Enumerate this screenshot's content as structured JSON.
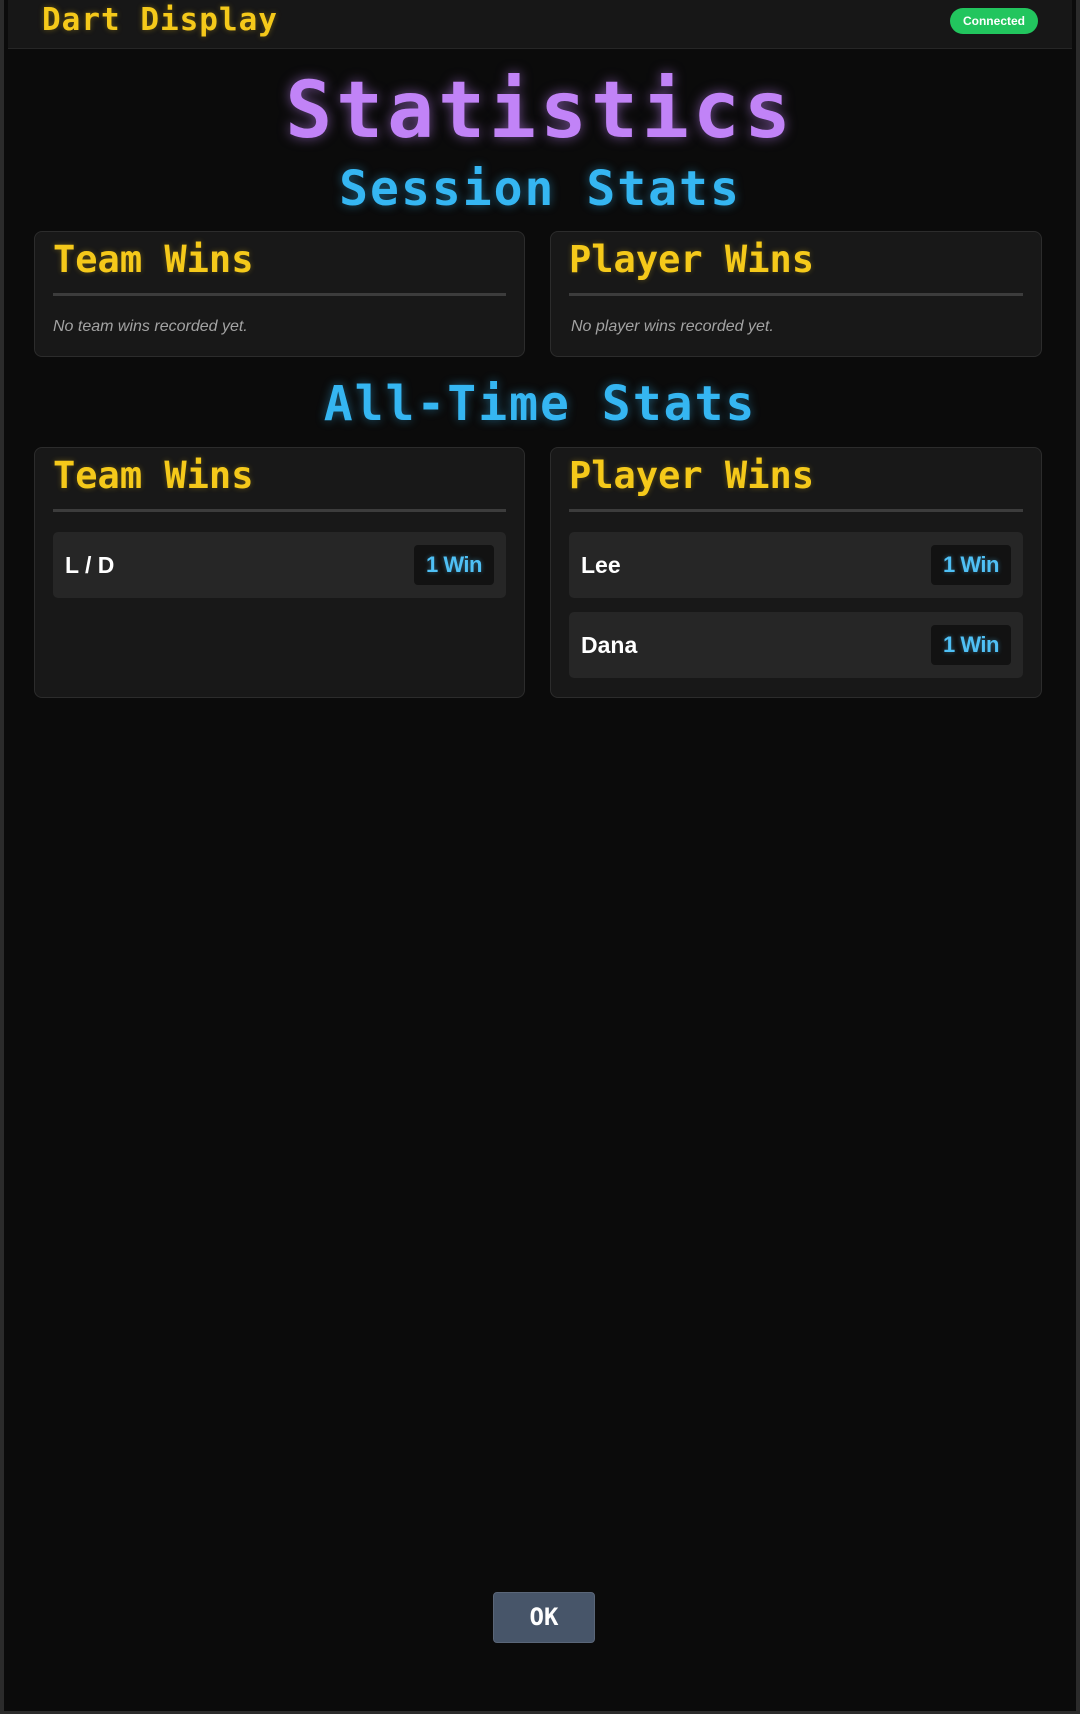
{
  "app": {
    "title": "Dart Display",
    "connection_status": "Connected"
  },
  "page": {
    "title": "Statistics"
  },
  "session": {
    "title": "Session Stats",
    "team_wins": {
      "title": "Team Wins",
      "empty_text": "No team wins recorded yet.",
      "rows": []
    },
    "player_wins": {
      "title": "Player Wins",
      "empty_text": "No player wins recorded yet.",
      "rows": []
    }
  },
  "all_time": {
    "title": "All-Time Stats",
    "team_wins": {
      "title": "Team Wins",
      "rows": [
        {
          "name": "L / D",
          "wins_label": "1 Win"
        }
      ]
    },
    "player_wins": {
      "title": "Player Wins",
      "rows": [
        {
          "name": "Lee",
          "wins_label": "1 Win"
        },
        {
          "name": "Dana",
          "wins_label": "1 Win"
        }
      ]
    }
  },
  "actions": {
    "ok_label": "OK"
  },
  "colors": {
    "accent_yellow": "#f5c91a",
    "accent_purple": "#c183f7",
    "accent_blue": "#35b6f2",
    "status_green": "#22c55e",
    "button_slate": "#475569"
  }
}
